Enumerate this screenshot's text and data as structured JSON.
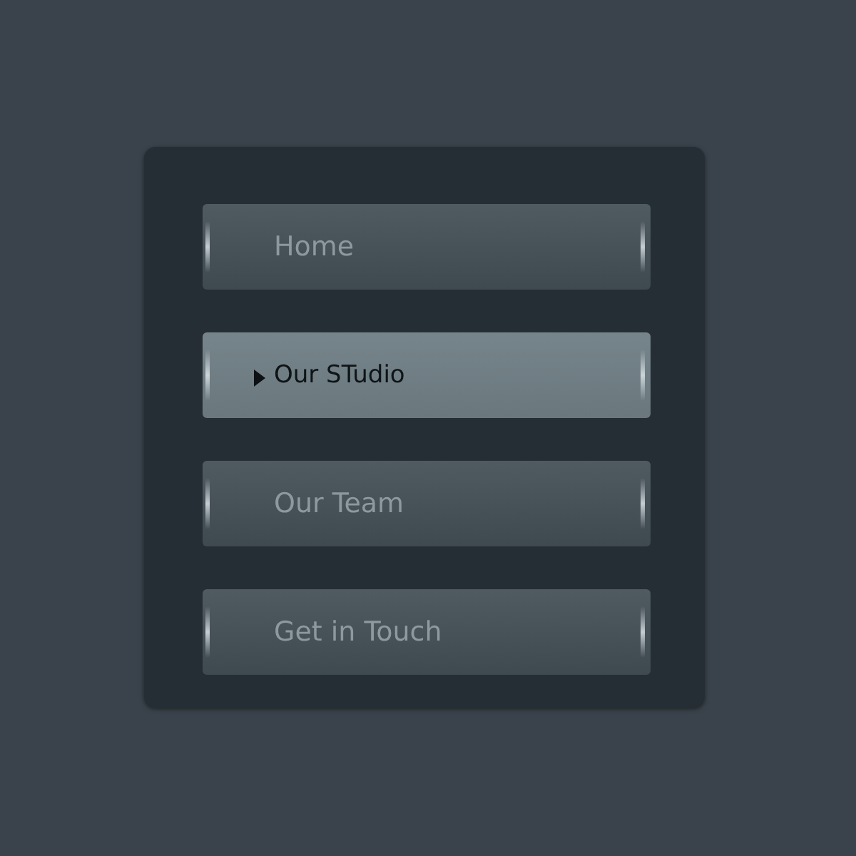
{
  "menu": [
    {
      "label": "Home",
      "selected": false
    },
    {
      "label": "Our STudio",
      "selected": true
    },
    {
      "label": "Our Team",
      "selected": false
    },
    {
      "label": "Get in Touch",
      "selected": false
    }
  ]
}
